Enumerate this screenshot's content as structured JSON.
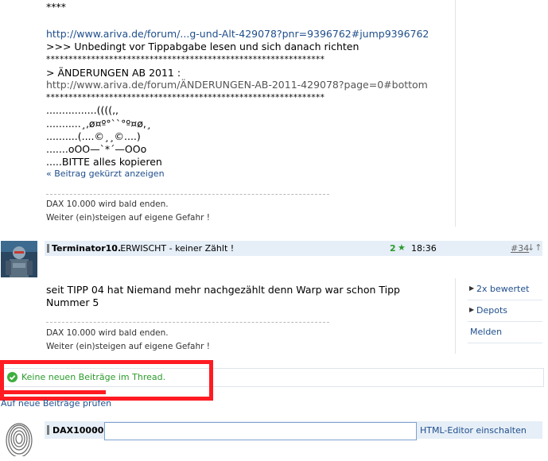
{
  "top_post": {
    "lines": [
      "****",
      "",
      "http://www.ariva.de/forum/...g-und-Alt-429078?pnr=9396762#jump9396762",
      ">>>   Unbedingt vor Tippabgabe lesen und sich danach richten",
      "**************************************************************",
      "> ÄNDERUNGEN AB 2011 :",
      "http://www.ariva.de/forum/ÄNDERUNGEN-AB-2011-429078?page=0#bottom",
      "**************************************************************",
      "",
      "................((((,,",
      "...........¸,ø¤º°``°º¤ø,¸",
      "..........(....©¸¸©....)",
      ".......oOO—`*´—OOo",
      ".....BITTE alles kopieren"
    ],
    "collapse_link": "« Beitrag gekürzt anzeigen",
    "signature_lines": [
      "DAX 10.000 wird bald enden.",
      "Weiter (ein)steigen auf eigene Gefahr !"
    ]
  },
  "second_post": {
    "author": "Terminator10.",
    "title": " : ERWISCHT - keiner Zählt !",
    "stars": "2",
    "time": "18:36",
    "number": "#34",
    "arrows": "↓↑",
    "body": [
      "seit TIPP 04 hat Niemand mehr nachgezählt denn Warp war schon Tipp",
      "Nummer 5"
    ],
    "signature_lines": [
      "DAX 10.000 wird bald enden.",
      "Weiter (ein)steigen auf eigene Gefahr !"
    ],
    "side_actions": [
      "2x bewertet",
      "Depots",
      "Melden"
    ]
  },
  "notice": {
    "text": "Keine neuen Beiträge im Thread.",
    "check_link": "Auf neue Beiträge prüfen"
  },
  "reply": {
    "user": "DAX10000",
    "colon": " :",
    "input_value": "",
    "editor_link": "HTML-Editor einschalten"
  },
  "colors": {
    "link": "#1f4e8c",
    "header_bg": "#e6eef7",
    "success": "#2a9b2a",
    "highlight": "#ff1b22"
  }
}
